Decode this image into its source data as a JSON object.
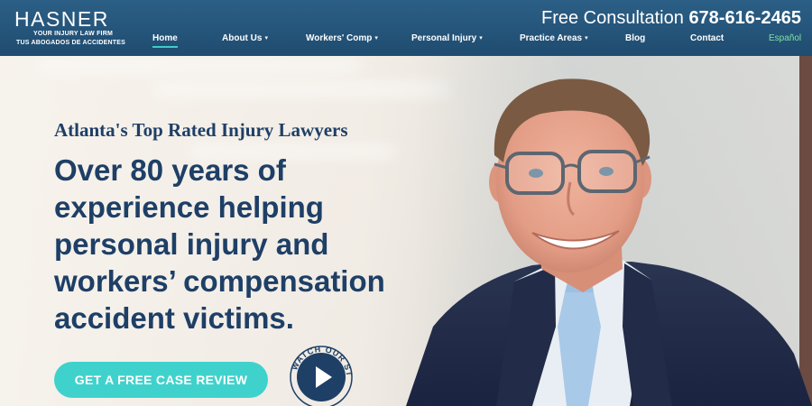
{
  "header": {
    "logo": {
      "name": "HASNER",
      "tagline_en": "YOUR INJURY LAW FIRM",
      "tagline_es": "TUS ABOGADOS DE ACCIDENTES"
    },
    "consultation": {
      "label": "Free Consultation",
      "phone": "678-616-2465"
    },
    "nav": [
      {
        "label": "Home",
        "active": true,
        "dropdown": false
      },
      {
        "label": "About Us",
        "active": false,
        "dropdown": true
      },
      {
        "label": "Workers' Comp",
        "active": false,
        "dropdown": true
      },
      {
        "label": "Personal Injury",
        "active": false,
        "dropdown": true
      },
      {
        "label": "Practice Areas",
        "active": false,
        "dropdown": true
      },
      {
        "label": "Blog",
        "active": false,
        "dropdown": false
      },
      {
        "label": "Contact",
        "active": false,
        "dropdown": false
      },
      {
        "label": "Español",
        "active": false,
        "dropdown": false
      }
    ],
    "caret_glyph": "▾"
  },
  "hero": {
    "subtitle": "Atlanta's Top Rated Injury Lawyers",
    "headline": "Over 80 years of experience helping personal injury and workers’ compensation accident victims.",
    "cta_label": "GET A FREE CASE REVIEW",
    "watch_label": "WATCH OUR STORY"
  },
  "colors": {
    "header": "#245679",
    "navy_text": "#1e3f66",
    "accent_teal": "#3fd2cc",
    "spanish_link": "#7fe2a6"
  },
  "icons": {
    "play": "play-icon",
    "caret": "chevron-down-icon"
  }
}
